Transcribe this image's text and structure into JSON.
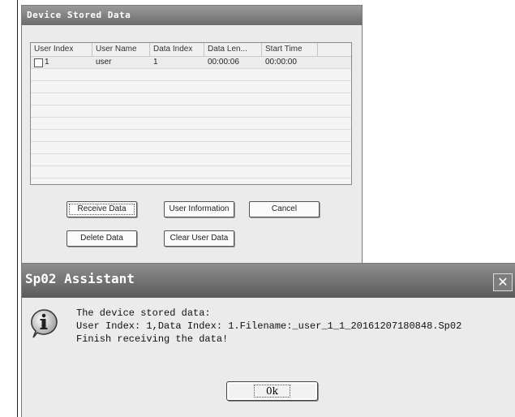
{
  "device_window": {
    "title": "Device Stored Data",
    "columns": [
      "User Index",
      "User Name",
      "Data Index",
      "Data Len...",
      "Start Time"
    ],
    "rows": [
      {
        "checked": false,
        "user_index": "1",
        "user_name": "user",
        "data_index": "1",
        "data_length": "00:00:06",
        "start_time": "00:00:00"
      }
    ],
    "buttons": {
      "receive": "Receive Data",
      "user_info": "User Information",
      "cancel": "Cancel",
      "delete": "Delete Data",
      "clear": "Clear User Data"
    }
  },
  "dialog": {
    "title": "Sp02 Assistant",
    "close_icon": "close-icon",
    "info_icon": "info-icon",
    "message_lines": [
      "The device stored data:",
      "User Index: 1,Data Index: 1.Filename:_user_1_1_20161207180848.Sp02",
      "Finish receiving the data!"
    ],
    "ok_label": "0k"
  }
}
